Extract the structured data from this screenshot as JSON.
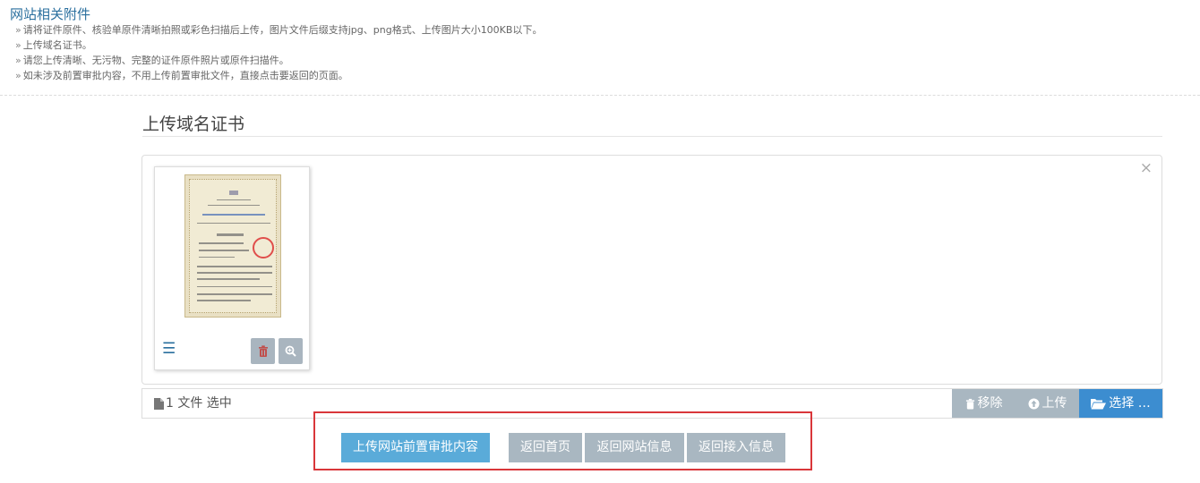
{
  "section": {
    "title": "网站相关附件",
    "bullet": "»",
    "notes": [
      "请将证件原件、核验单原件清晰拍照或彩色扫描后上传，图片文件后缀支持jpg、png格式、上传图片大小100KB以下。",
      "上传域名证书。",
      "请您上传清晰、无污物、完整的证件原件照片或原件扫描件。",
      "如未涉及前置审批内容，不用上传前置审批文件，直接点击要返回的页面。"
    ]
  },
  "upload": {
    "heading": "上传域名证书",
    "close_symbol": "×",
    "thumbnail": {
      "menu_icon": "menu-icon",
      "delete_icon": "trash-icon",
      "zoom_icon": "zoom-in-icon"
    },
    "file_caption": "1 文件 选中",
    "file_icon": "file-icon",
    "buttons": {
      "remove": "移除",
      "upload": "上传",
      "select": "选择 …"
    }
  },
  "actions": {
    "submit": "上传网站前置审批内容",
    "home": "返回首页",
    "site_info": "返回网站信息",
    "access_info": "返回接入信息"
  },
  "colors": {
    "link_blue": "#2a6f9e",
    "primary_button": "#5aabd9",
    "select_button": "#3c8dd0",
    "gray_button": "#a9b7c1",
    "highlight_frame": "#d9363a"
  }
}
